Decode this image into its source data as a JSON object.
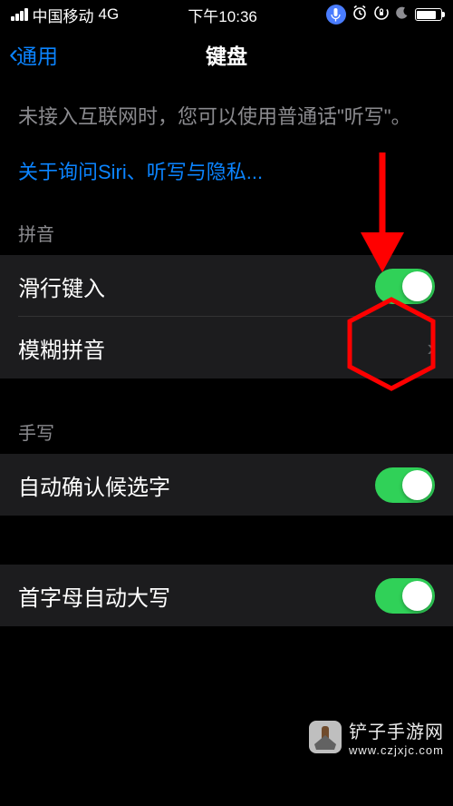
{
  "status": {
    "carrier": "中国移动",
    "network": "4G",
    "time": "下午10:36"
  },
  "nav": {
    "back_label": "通用",
    "title": "键盘"
  },
  "info": {
    "text": "未接入互联网时，您可以使用普通话\"听写\"。",
    "link": "关于询问Siri、听写与隐私..."
  },
  "sections": {
    "pinyin": {
      "header": "拼音",
      "items": {
        "slide_typing": "滑行键入",
        "fuzzy_pinyin": "模糊拼音"
      }
    },
    "handwriting": {
      "header": "手写",
      "items": {
        "auto_confirm": "自动确认候选字"
      }
    },
    "other": {
      "items": {
        "auto_capitalize": "首字母自动大写"
      }
    }
  },
  "watermark": {
    "text": "铲子手游网",
    "url": "www.czjxjc.com"
  }
}
